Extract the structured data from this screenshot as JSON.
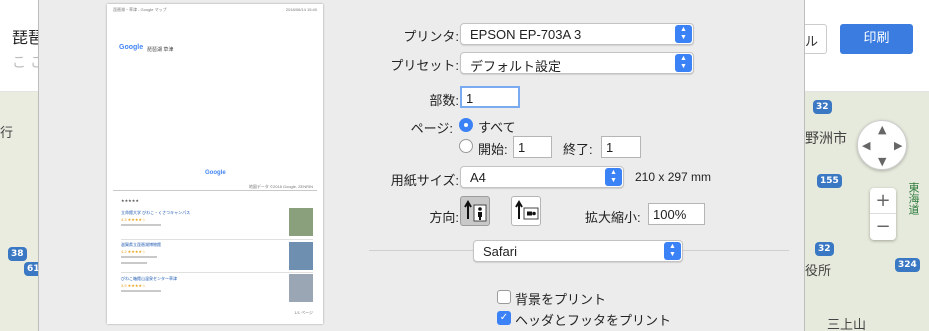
{
  "background": {
    "title": "琵琶",
    "subtitle": "ここ",
    "partial_button": "ル",
    "print_button": "印刷",
    "map_left": {
      "label_gyo": "行",
      "route_38": "38",
      "route_6": "61"
    },
    "map_right": {
      "route_32a": "32",
      "city": "野洲市",
      "route_155": "155",
      "highway": "東海道",
      "route_32b": "32",
      "office": "役所",
      "route_324": "324",
      "town": "三上山",
      "zoom_in": "+",
      "zoom_out": "−"
    }
  },
  "dialog": {
    "printer": {
      "label": "プリンタ:",
      "value": "EPSON EP-703A 3"
    },
    "preset": {
      "label": "プリセット:",
      "value": "デフォルト設定"
    },
    "copies": {
      "label": "部数:",
      "value": "1"
    },
    "pages": {
      "label": "ページ:",
      "all_label": "すべて",
      "from_label": "開始:",
      "from_value": "1",
      "to_label": "終了:",
      "to_value": "1"
    },
    "paper": {
      "label": "用紙サイズ:",
      "value": "A4",
      "dimensions": "210 x 297 mm"
    },
    "orientation": {
      "label": "方向:"
    },
    "scale": {
      "label": "拡大縮小:",
      "value": "100%"
    },
    "section": {
      "value": "Safari"
    },
    "options": {
      "print_backgrounds": "背景をプリント",
      "headers_footers": "ヘッダとフッタをプリント"
    }
  },
  "preview": {
    "header_left": "琵琶湖・草津 - Google マップ",
    "header_right": "2018/06/14 15:40",
    "logo": "Google",
    "search_text": "琵琶湖 草津",
    "map_logo": "Google",
    "copyright": "地図データ ©2018 Google, ZENRIN",
    "rating_row": "★★★★★",
    "places": [
      {
        "name": "立命館大学 びわこ・くさつキャンパス",
        "rating": "4.3 ★★★★☆"
      },
      {
        "name": "滋賀県立琵琶湖博物館",
        "rating": "4.2 ★★★★☆"
      },
      {
        "name": "びわこ箱館山温泉センター草津",
        "rating": "3.9 ★★★★☆"
      }
    ],
    "footer_right": "1/1 ページ"
  },
  "colors": {
    "accent": "#3b82f6",
    "print_button": "#3a7ce0"
  }
}
